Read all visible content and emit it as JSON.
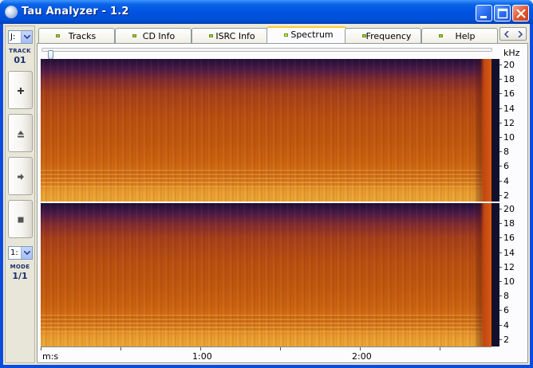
{
  "window": {
    "title": "Tau Analyzer - 1.2"
  },
  "toolbar": {
    "drive": "J:",
    "track_label": "TRACK",
    "track_number": "01",
    "mode_select": "1:",
    "mode_label": "MODE",
    "mode_value": "1/1",
    "buttons": [
      {
        "name": "plus-button",
        "icon": "plus-icon"
      },
      {
        "name": "eject-button",
        "icon": "eject-icon"
      },
      {
        "name": "play-button",
        "icon": "play-icon"
      },
      {
        "name": "stop-button",
        "icon": "stop-icon"
      }
    ]
  },
  "tabs": [
    {
      "label": "Tracks",
      "active": false
    },
    {
      "label": "CD Info",
      "active": false
    },
    {
      "label": "ISRC Info",
      "active": false
    },
    {
      "label": "Spectrum",
      "active": true
    },
    {
      "label": "Frequency",
      "active": false
    },
    {
      "label": "Help",
      "active": false
    }
  ],
  "spectrum": {
    "unit_label": "kHz",
    "ticks": [
      "20",
      "18",
      "16",
      "14",
      "12",
      "10",
      "8",
      "6",
      "4",
      "2"
    ],
    "time_axis": {
      "unit": "m:s",
      "labels": [
        "1:00",
        "2:00"
      ]
    },
    "colors": {
      "low": "#1E0E36",
      "mid": "#C45A0E",
      "high": "#F0AA36"
    }
  }
}
